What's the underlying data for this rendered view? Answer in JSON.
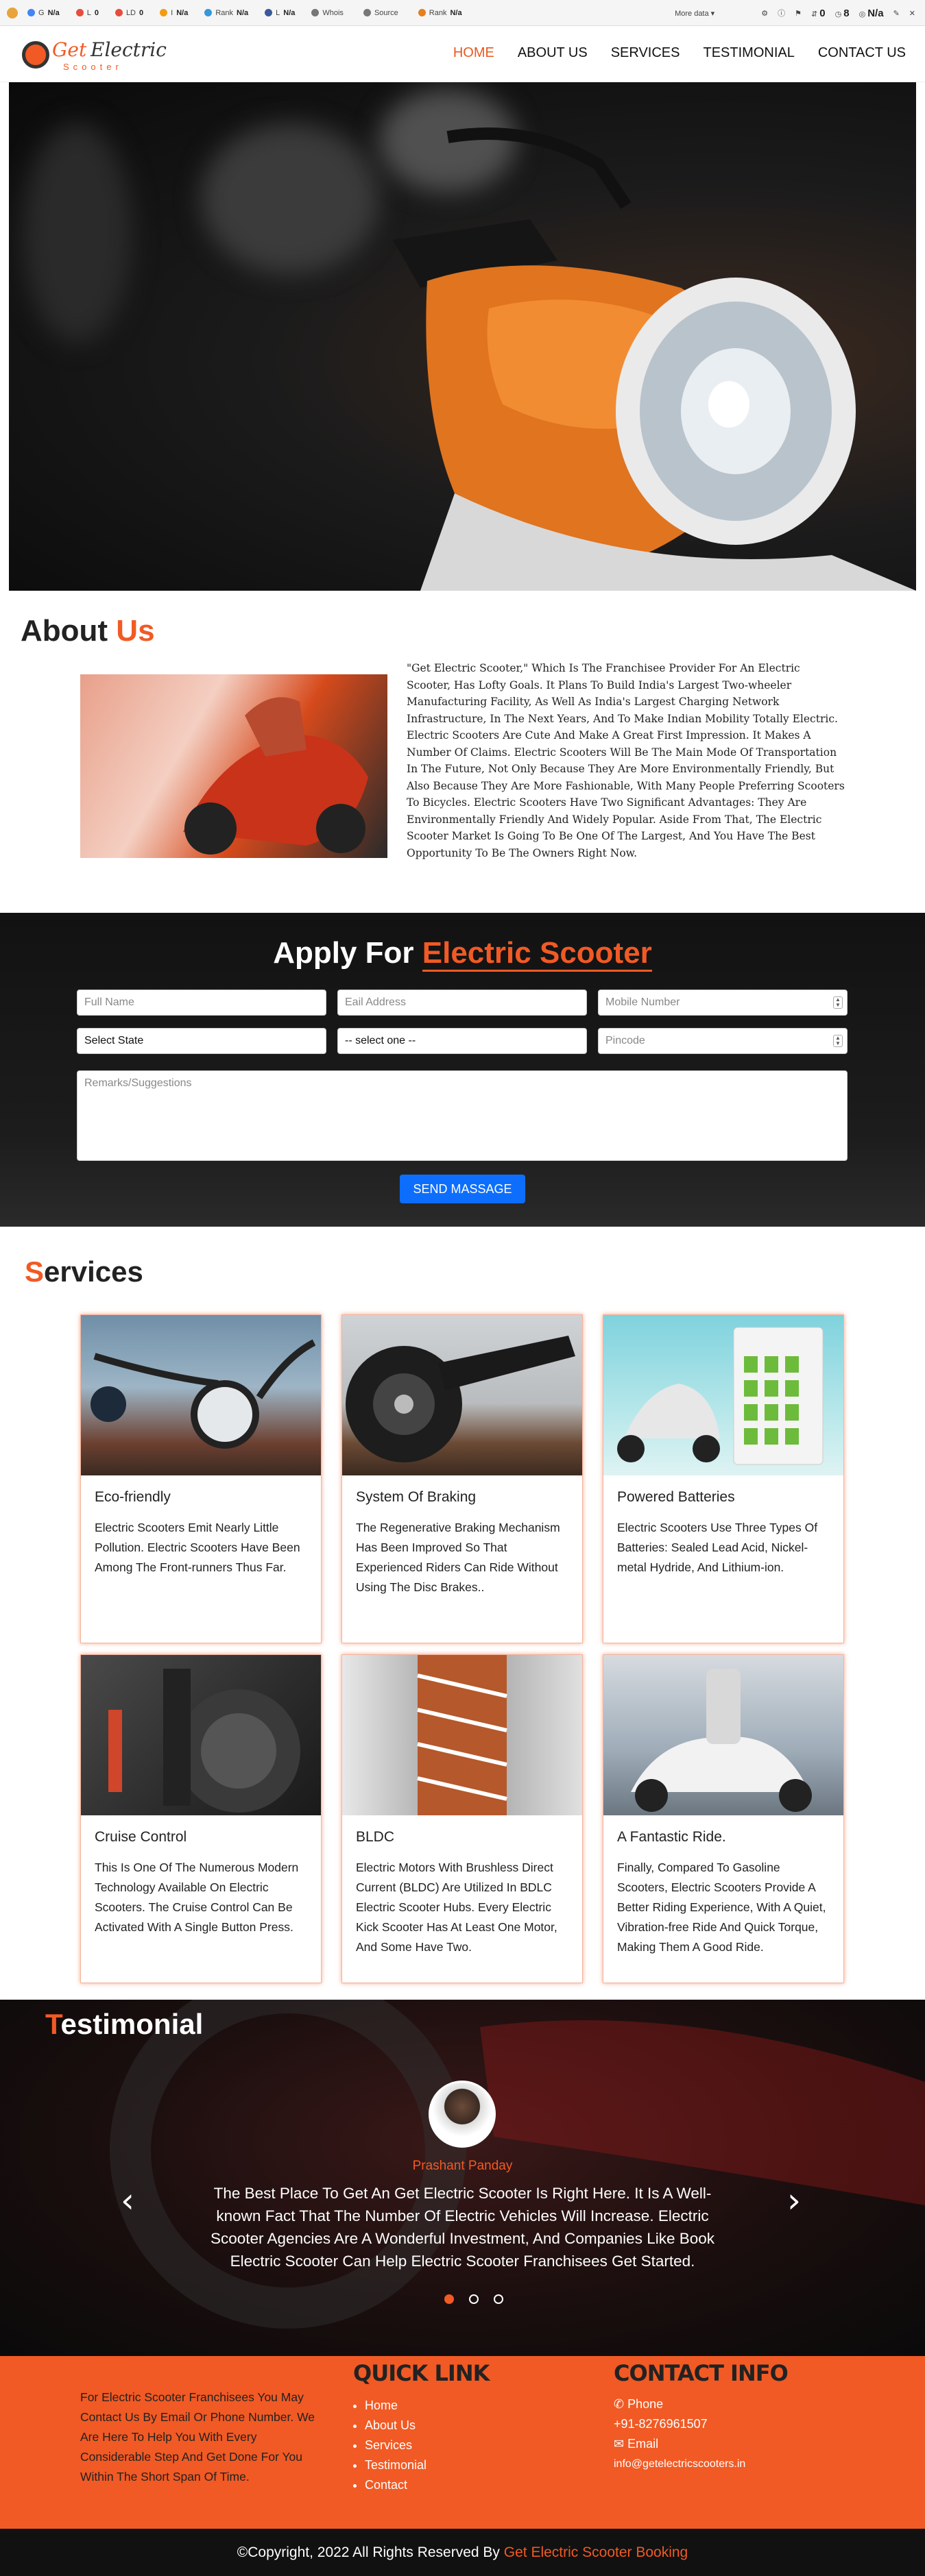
{
  "seo_bar": {
    "items": [
      {
        "icon": "google-icon",
        "label": "G",
        "value": "N/a",
        "color": "#4285f4"
      },
      {
        "icon": "links-icon",
        "label": "L",
        "value": "0",
        "color": "#e74c3c"
      },
      {
        "icon": "linking-domains-icon",
        "label": "LD",
        "value": "0",
        "color": "#e74c3c"
      },
      {
        "icon": "index-icon",
        "label": "I",
        "value": "N/a",
        "color": "#f39c12"
      },
      {
        "icon": "rank-icon",
        "label": "Rank",
        "value": "N/a",
        "color": "#3498db"
      },
      {
        "icon": "facebook-icon",
        "label": "L",
        "value": "N/a",
        "color": "#3b5998"
      },
      {
        "icon": "whois-icon",
        "label": "Whois",
        "value": "",
        "color": "#777"
      },
      {
        "icon": "source-icon",
        "label": "Source",
        "value": "",
        "color": "#777"
      },
      {
        "icon": "alexa-rank-icon",
        "label": "Rank",
        "value": "N/a",
        "color": "#e67e22"
      }
    ],
    "more_label": "More data",
    "right_counts": [
      "0",
      "8",
      "N/a"
    ]
  },
  "nav": {
    "logo_get": "Get",
    "logo_electric": "Electric",
    "logo_scooter": "Scooter",
    "links": [
      "HOME",
      "ABOUT US",
      "SERVICES",
      "TESTIMONIAL",
      "CONTACT US"
    ]
  },
  "about": {
    "title": "About",
    "title_highlight": "Us",
    "text": "\"Get Electric Scooter,\" Which Is The Franchisee Provider For An Electric Scooter, Has Lofty Goals. It Plans To Build India's Largest Two-wheeler Manufacturing Facility, As Well As India's Largest Charging Network Infrastructure, In The Next Years, And To Make Indian Mobility Totally Electric. Electric Scooters Are Cute And Make A Great First Impression. It Makes A Number Of Claims. Electric Scooters Will Be The Main Mode Of Transportation In The Future, Not Only Because They Are More Environmentally Friendly, But Also Because They Are More Fashionable, With Many People Preferring Scooters To Bicycles. Electric Scooters Have Two Significant Advantages: They Are Environmentally Friendly And Widely Popular. Aside From That, The Electric Scooter Market Is Going To Be One Of The Largest, And You Have The Best Opportunity To Be The Owners Right Now."
  },
  "apply": {
    "title": "Apply For",
    "title_highlight": "Electric Scooter",
    "full_name_placeholder": "Full Name",
    "email_placeholder": "Eail Address",
    "mobile_placeholder": "Mobile Number",
    "state_selected": "Select State",
    "city_selected": "-- select one --",
    "pincode_placeholder": "Pincode",
    "remarks_placeholder": "Remarks/Suggestions",
    "submit_label": "SEND MASSAGE"
  },
  "services": {
    "title_cap": "S",
    "title_rest": "ervices",
    "cards": [
      {
        "title": "Eco-friendly",
        "desc": "Electric Scooters Emit Nearly Little Pollution. Electric Scooters Have Been Among The Front-runners Thus Far."
      },
      {
        "title": "System Of Braking",
        "desc": "The Regenerative Braking Mechanism Has Been Improved So That Experienced Riders Can Ride Without Using The Disc Brakes.."
      },
      {
        "title": "Powered Batteries",
        "desc": "Electric Scooters Use Three Types Of Batteries: Sealed Lead Acid, Nickel-metal Hydride, And Lithium-ion."
      },
      {
        "title": "Cruise Control",
        "desc": "This Is One Of The Numerous Modern Technology Available On Electric Scooters. The Cruise Control Can Be Activated With A Single Button Press."
      },
      {
        "title": "BLDC",
        "desc": "Electric Motors With Brushless Direct Current (BLDC) Are Utilized In BDLC Electric Scooter Hubs. Every Electric Kick Scooter Has At Least One Motor, And Some Have Two."
      },
      {
        "title": "A Fantastic Ride.",
        "desc": "Finally, Compared To Gasoline Scooters, Electric Scooters Provide A Better Riding Experience, With A Quiet, Vibration-free Ride And Quick Torque, Making Them A Good Ride."
      }
    ]
  },
  "testimonial": {
    "title_cap": "T",
    "title_rest": "estimonial",
    "name": "Prashant Panday",
    "quote": "The Best Place To Get An Get Electric Scooter Is Right Here. It Is A Well-known Fact That The Number Of Electric Vehicles Will Increase. Electric Scooter Agencies Are A Wonderful Investment, And Companies Like Book Electric Scooter Can Help Electric Scooter Franchisees Get Started.",
    "prev_symbol": "‹",
    "next_symbol": "›"
  },
  "footer": {
    "about": "For Electric Scooter Franchisees You May Contact Us By Email Or Phone Number. We Are Here To Help You With Every Considerable Step And Get Done For You Within The Short Span Of Time.",
    "quick_link_title": "QUICK LINK",
    "quick_links": [
      "Home",
      "About Us",
      "Services",
      "Testimonial",
      "Contact"
    ],
    "contact_title": "CONTACT INFO",
    "phone_label": "Phone",
    "phone": "+91-8276961507",
    "email_label": "Email",
    "email": "info@getelectricscooters.in"
  },
  "copyright": {
    "text": "©Copyright, 2022 All Rights Reserved By",
    "brand": "Get Electric Scooter Booking"
  },
  "colors": {
    "accent": "#f15a24",
    "primary_button": "#0d6efd",
    "dark_section": "#151515"
  }
}
